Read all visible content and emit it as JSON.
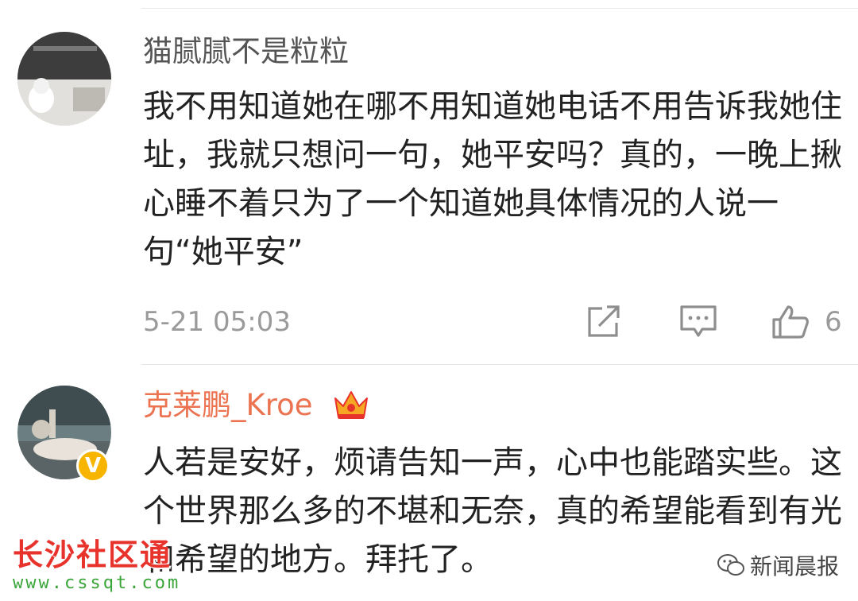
{
  "comments": [
    {
      "username": "猫腻腻不是粒粒",
      "text": "我不用知道她在哪不用知道她电话不用告诉我她住址，我就只想问一句，她平安吗？真的，一晚上揪心睡不着只为了一个知道她具体情况的人说一句“她平安”",
      "time": "5-21 05:03",
      "likes": "6"
    },
    {
      "username": "克莱鹏_Kroe",
      "text": "人若是安好，烦请告知一声，心中也能踏实些。这个世界那么多的不堪和无奈，真的希望能看到有光和希望的地方。拜托了。"
    }
  ],
  "watermarks": {
    "left_title": "长沙社区通",
    "left_url": "www.cssqt.com",
    "right_label": "新闻晨报"
  },
  "colors": {
    "username_vip": "#eb7350",
    "username_normal": "#555555",
    "meta_gray": "#9a9a9a"
  },
  "icons": [
    "share-icon",
    "comment-icon",
    "like-icon",
    "crown-vip-icon",
    "verified-badge-icon",
    "wechat-icon"
  ]
}
